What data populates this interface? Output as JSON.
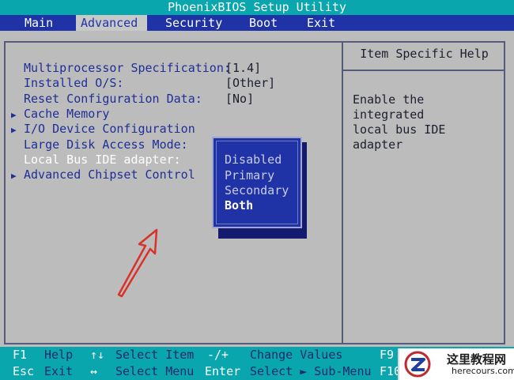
{
  "title": "PhoenixBIOS Setup Utility",
  "menu": [
    {
      "label": "Main"
    },
    {
      "label": "Advanced"
    },
    {
      "label": "Security"
    },
    {
      "label": "Boot"
    },
    {
      "label": "Exit"
    }
  ],
  "settings": [
    {
      "label": "Multiprocessor Specification:",
      "value": "[1.4]",
      "submenu": false
    },
    {
      "label": "Installed O/S:",
      "value": "[Other]",
      "submenu": false
    },
    {
      "label": "Reset Configuration Data:",
      "value": "[No]",
      "submenu": false
    },
    {
      "label": "Cache Memory",
      "value": "",
      "submenu": true
    },
    {
      "label": "I/O Device Configuration",
      "value": "",
      "submenu": true
    },
    {
      "label": "Large Disk Access Mode:",
      "value": "",
      "submenu": false
    },
    {
      "label": "Local Bus IDE adapter:",
      "value": "",
      "submenu": false
    },
    {
      "label": "Advanced Chipset Control",
      "value": "",
      "submenu": true
    }
  ],
  "popup_options": [
    "Disabled",
    "Primary",
    "Secondary",
    "Both"
  ],
  "popup_selected": "Both",
  "help": {
    "title": "Item Specific Help",
    "text": "Enable the integrated\nlocal bus IDE adapter"
  },
  "footer": {
    "row1": [
      {
        "key": "F1",
        "desc": "Help"
      },
      {
        "key": "↑↓",
        "desc": "Select Item"
      },
      {
        "key": "-/+",
        "desc": "Change Values"
      },
      {
        "key": "F9",
        "desc": ""
      }
    ],
    "row2": [
      {
        "key": "Esc",
        "desc": "Exit"
      },
      {
        "key": "↔",
        "desc": "Select Menu"
      },
      {
        "key": "Enter",
        "desc": "Select ► Sub-Menu"
      },
      {
        "key": "F10",
        "desc": ""
      }
    ]
  },
  "watermark": {
    "title": "这里教程网",
    "subtitle": "herecours.com"
  },
  "colors": {
    "title_bar": "#0aa6ad",
    "menu_bar": "#1f33a6",
    "panel": "#bcbcbc",
    "popup": "#1f33a6",
    "arrow": "#d9322a"
  }
}
